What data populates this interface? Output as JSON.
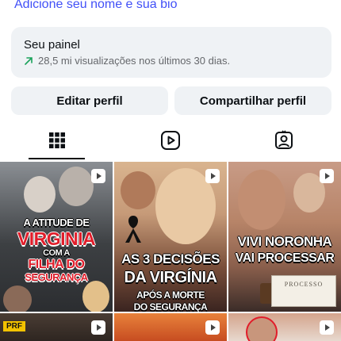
{
  "profile": {
    "bio_link": "Adicione seu nome e sua bio"
  },
  "panel": {
    "title": "Seu painel",
    "stats": "28,5 mi visualizações nos últimos 30 dias."
  },
  "buttons": {
    "edit": "Editar perfil",
    "share": "Compartilhar perfil"
  },
  "tabs": [
    {
      "name": "posts",
      "icon": "grid-icon",
      "active": true
    },
    {
      "name": "reels",
      "icon": "reels-icon",
      "active": false
    },
    {
      "name": "tagged",
      "icon": "tagged-icon",
      "active": false
    }
  ],
  "posts": [
    {
      "lines": [
        "A ATITUDE DE",
        "VIRGINIA",
        "COM A",
        "FILHA DO",
        "SEGURANÇA"
      ]
    },
    {
      "lines": [
        "AS 3 DECISÕES",
        "DA VIRGÍNIA",
        "APÓS A MORTE",
        "DO SEGURANÇA"
      ]
    },
    {
      "lines": [
        "VIVI NORONHA",
        "VAI PROCESSAR"
      ],
      "document_label": "PROCESSO"
    },
    {
      "badge": "PRF"
    }
  ],
  "colors": {
    "link_blue": "#4150f7",
    "panel_bg": "#eff2f5",
    "trend_green": "#1aa25a",
    "headline_red": "#e11d2a"
  }
}
